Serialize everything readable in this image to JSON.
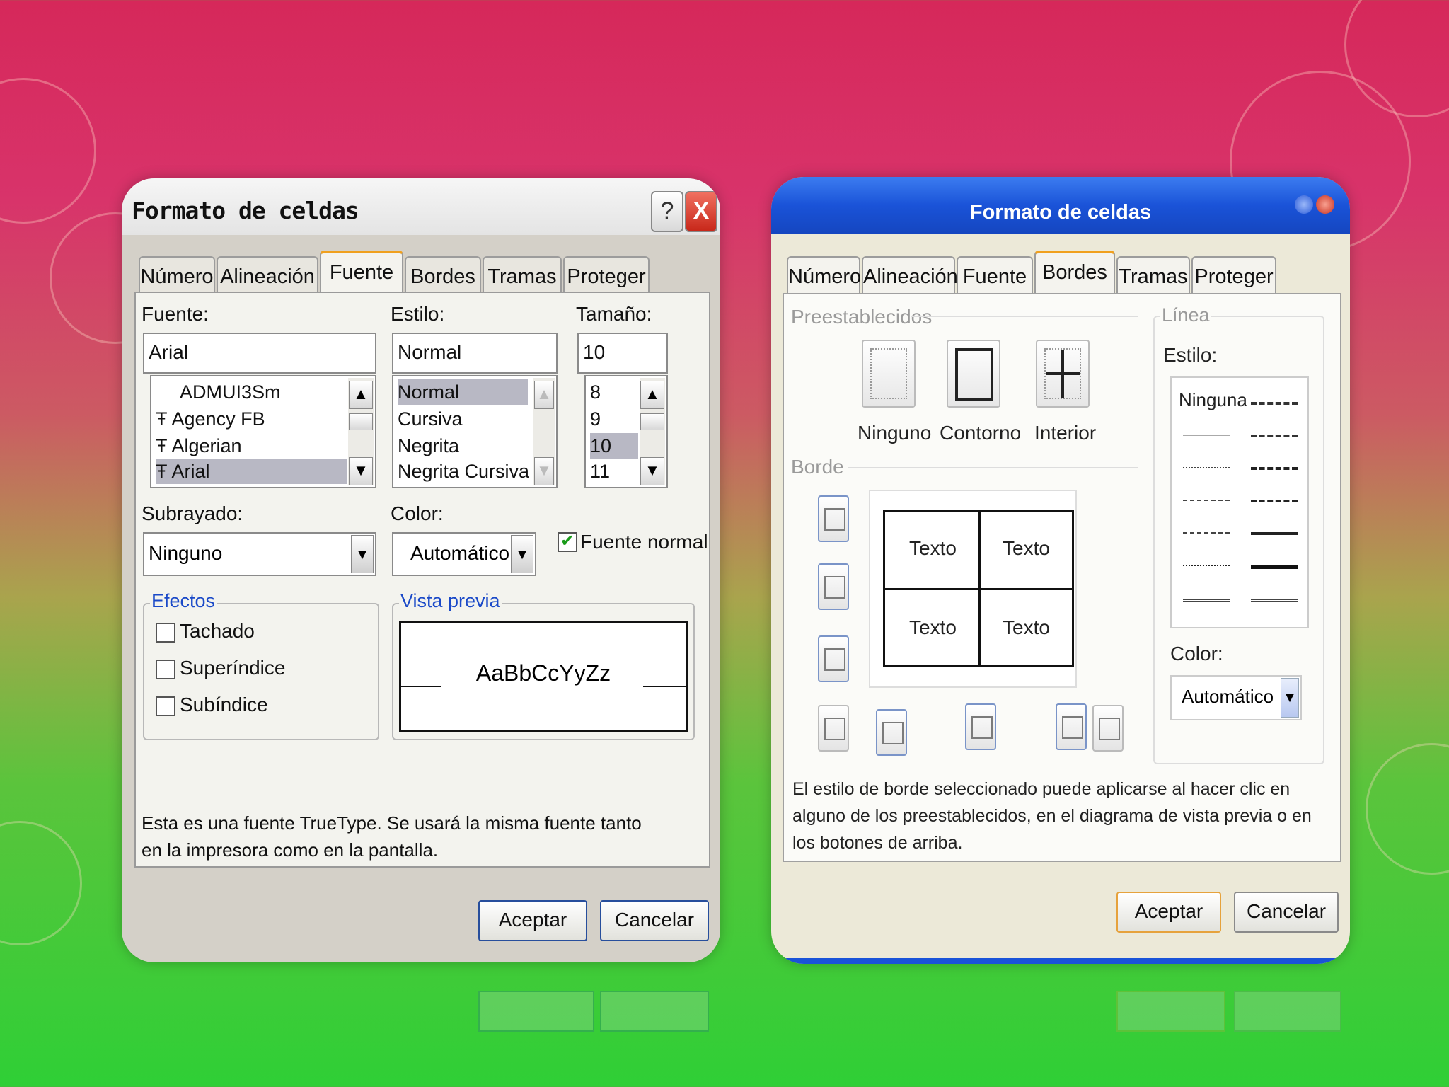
{
  "dialog_left": {
    "title": "Formato de celdas",
    "help": "?",
    "close": "X",
    "tabs": [
      "Número",
      "Alineación",
      "Fuente",
      "Bordes",
      "Tramas",
      "Proteger"
    ],
    "selected_tab": "Fuente",
    "font_label": "Fuente:",
    "font_value": "Arial",
    "font_list": [
      "ADMUI3Sm",
      "Agency FB",
      "Algerian",
      "Arial"
    ],
    "style_label": "Estilo:",
    "style_value": "Normal",
    "style_list": [
      "Normal",
      "Cursiva",
      "Negrita",
      "Negrita Cursiva"
    ],
    "size_label": "Tamaño:",
    "size_value": "10",
    "size_list": [
      "8",
      "9",
      "10",
      "11"
    ],
    "underline_label": "Subrayado:",
    "underline_value": "Ninguno",
    "color_label": "Color:",
    "color_value": "Automático",
    "normal_font": "Fuente normal",
    "effects_label": "Efectos",
    "effects": [
      "Tachado",
      "Superíndice",
      "Subíndice"
    ],
    "preview_label": "Vista previa",
    "preview_text": "AaBbCcYyZz",
    "info": "Esta es una fuente TrueType. Se usará la misma fuente tanto en la impresora como en la pantalla.",
    "ok": "Aceptar",
    "cancel": "Cancelar"
  },
  "dialog_right": {
    "title": "Formato de celdas",
    "tabs": [
      "Número",
      "Alineación",
      "Fuente",
      "Bordes",
      "Tramas",
      "Proteger"
    ],
    "selected_tab": "Bordes",
    "presets_label": "Preestablecidos",
    "presets": [
      "Ninguno",
      "Contorno",
      "Interior"
    ],
    "border_label": "Borde",
    "preview_cells": [
      "Texto",
      "Texto",
      "Texto",
      "Texto"
    ],
    "line_label": "Línea",
    "style_label": "Estilo:",
    "none_style": "Ninguna",
    "color_label": "Color:",
    "color_value": "Automático",
    "info": "El estilo de borde seleccionado puede aplicarse al hacer clic en alguno de los preestablecidos, en el diagrama de vista previa o en los botones de arriba.",
    "ok": "Aceptar",
    "cancel": "Cancelar"
  }
}
